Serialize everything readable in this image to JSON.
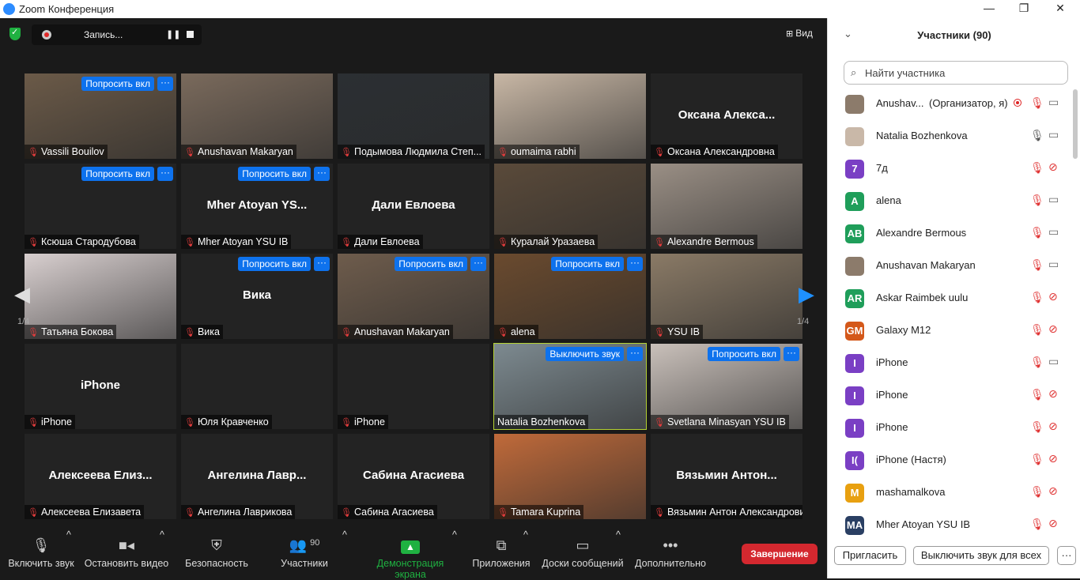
{
  "window": {
    "title": "Zoom Конференция",
    "minimize": "—",
    "restore": "❐",
    "close": "✕"
  },
  "topbar": {
    "record_label": "Запись...",
    "pause_glyph": "❚❚",
    "view_label": "Вид",
    "view_icon": "⊞"
  },
  "nav": {
    "left_arrow": "◀",
    "right_arrow": "▶",
    "page_left": "1/4",
    "page_right": "1/4"
  },
  "colors": {
    "accent": "#0e72ed",
    "end": "#d4282f",
    "green": "#1fb141",
    "active_border": "#b5d233"
  },
  "tiles": [
    {
      "name": "Vassili Bouilov",
      "big": "",
      "ask": "Попросить вкл",
      "more": "···",
      "bg": "#6b5a48"
    },
    {
      "name": "Anushavan Makaryan",
      "big": "",
      "ask": "",
      "more": "",
      "bg": "#7a6a5c"
    },
    {
      "name": "Подымова Людмила Степ...",
      "big": "",
      "ask": "",
      "more": "",
      "bg": "#2b2f33"
    },
    {
      "name": "oumaima rabhi",
      "big": "",
      "ask": "",
      "more": "",
      "bg": "#c8b7a5"
    },
    {
      "name": "Оксана Александровна",
      "big": "Оксана  Алекса...",
      "ask": "",
      "more": "",
      "bg": ""
    },
    {
      "name": "Ксюша Стародубова",
      "big": "",
      "ask": "Попросить вкл",
      "more": "···",
      "bg": ""
    },
    {
      "name": "Mher Atoyan YSU IB",
      "big": "Mher  Atoyan  YS...",
      "ask": "Попросить вкл",
      "more": "···",
      "bg": ""
    },
    {
      "name": "Дали Евлоева",
      "big": "Дали Евлоева",
      "ask": "",
      "more": "",
      "bg": ""
    },
    {
      "name": "Куралай Уразаева",
      "big": "",
      "ask": "",
      "more": "",
      "bg": "#5a4a3a"
    },
    {
      "name": "Alexandre Bermous",
      "big": "",
      "ask": "",
      "more": "",
      "bg": "#9a8f85"
    },
    {
      "name": "Татьяна Бокова",
      "big": "",
      "ask": "",
      "more": "",
      "bg": "#d8cfcf"
    },
    {
      "name": "Вика",
      "big": "Вика",
      "ask": "Попросить вкл",
      "more": "···",
      "bg": ""
    },
    {
      "name": "Anushavan Makaryan",
      "big": "",
      "ask": "Попросить вкл",
      "more": "···",
      "bg": "#6e5c4c"
    },
    {
      "name": "alena",
      "big": "",
      "ask": "Попросить вкл",
      "more": "···",
      "bg": "#6a4a2e"
    },
    {
      "name": "YSU IB",
      "big": "",
      "ask": "",
      "more": "",
      "bg": "#8a7a66"
    },
    {
      "name": "iPhone",
      "big": "iPhone",
      "ask": "",
      "more": "",
      "bg": ""
    },
    {
      "name": "Юля Кравченко",
      "big": "",
      "ask": "",
      "more": "",
      "bg": ""
    },
    {
      "name": "iPhone",
      "big": "",
      "ask": "",
      "more": "",
      "bg": ""
    },
    {
      "name": "Natalia Bozhenkova",
      "big": "",
      "ask": "Выключить звук",
      "more": "···",
      "bg": "#7d8a90",
      "active": true
    },
    {
      "name": "Svetlana Minasyan YSU IB",
      "big": "",
      "ask": "Попросить вкл",
      "more": "···",
      "bg": "#c9c0ba"
    },
    {
      "name": "Алексеева Елизавета",
      "big": "Алексеева  Елиз...",
      "ask": "",
      "more": "",
      "bg": ""
    },
    {
      "name": "Ангелина Лаврикова",
      "big": "Ангелина  Лавр...",
      "ask": "",
      "more": "",
      "bg": ""
    },
    {
      "name": "Сабина Агасиева",
      "big": "Сабина Агасиева",
      "ask": "",
      "more": "",
      "bg": ""
    },
    {
      "name": "Tamara Kuprina",
      "big": "",
      "ask": "",
      "more": "",
      "bg": "#c06a3a"
    },
    {
      "name": "Вязьмин Антон Александрович",
      "big": "Вязьмин  Антон...",
      "ask": "",
      "more": "",
      "bg": ""
    }
  ],
  "toolbar": {
    "audio": "Включить звук",
    "video": "Остановить видео",
    "security": "Безопасность",
    "participants": "Участники",
    "participants_count": "90",
    "share": "Демонстрация экрана",
    "apps": "Приложения",
    "whiteboards": "Доски сообщений",
    "more": "Дополнительно",
    "end": "Завершение",
    "caret": "^"
  },
  "panel": {
    "title": "Участники (90)",
    "collapse_icon": "⌄",
    "search_placeholder": "Найти участника",
    "participants": [
      {
        "name": "Anushav...",
        "role": "(Организатор, я)",
        "avatar": "",
        "color": "#8c7b6b",
        "mic": "muted",
        "cam": "on",
        "rec": true
      },
      {
        "name": "Natalia Bozhenkova",
        "role": "",
        "avatar": "",
        "color": "#c9b8a8",
        "mic": "on",
        "cam": "on",
        "rec": false
      },
      {
        "name": "7д",
        "role": "",
        "avatar": "7",
        "color": "#7a3fc4",
        "mic": "muted",
        "cam": "off",
        "rec": false
      },
      {
        "name": "alena",
        "role": "",
        "avatar": "A",
        "color": "#1f9e5a",
        "mic": "muted",
        "cam": "on",
        "rec": false
      },
      {
        "name": "Alexandre Bermous",
        "role": "",
        "avatar": "AB",
        "color": "#1f9e5a",
        "mic": "muted",
        "cam": "on",
        "rec": false
      },
      {
        "name": "Anushavan Makaryan",
        "role": "",
        "avatar": "",
        "color": "#8c7b6b",
        "mic": "muted",
        "cam": "on",
        "rec": false
      },
      {
        "name": "Askar Raimbek uulu",
        "role": "",
        "avatar": "AR",
        "color": "#1f9e5a",
        "mic": "muted",
        "cam": "off",
        "rec": false
      },
      {
        "name": "Galaxy M12",
        "role": "",
        "avatar": "GM",
        "color": "#d4581a",
        "mic": "muted",
        "cam": "off",
        "rec": false
      },
      {
        "name": "iPhone",
        "role": "",
        "avatar": "I",
        "color": "#7a3fc4",
        "mic": "muted",
        "cam": "on",
        "rec": false
      },
      {
        "name": "iPhone",
        "role": "",
        "avatar": "I",
        "color": "#7a3fc4",
        "mic": "muted",
        "cam": "off",
        "rec": false
      },
      {
        "name": "iPhone",
        "role": "",
        "avatar": "I",
        "color": "#7a3fc4",
        "mic": "muted",
        "cam": "off",
        "rec": false
      },
      {
        "name": "iPhone (Настя)",
        "role": "",
        "avatar": "I(",
        "color": "#7a3fc4",
        "mic": "muted",
        "cam": "off",
        "rec": false
      },
      {
        "name": "mashamalkova",
        "role": "",
        "avatar": "M",
        "color": "#e8a010",
        "mic": "muted",
        "cam": "off",
        "rec": false
      },
      {
        "name": "Mher Atoyan YSU IB",
        "role": "",
        "avatar": "MA",
        "color": "#2a3f63",
        "mic": "muted",
        "cam": "off",
        "rec": false
      }
    ],
    "invite": "Пригласить",
    "mute_all": "Выключить звук для всех",
    "more": "···"
  }
}
